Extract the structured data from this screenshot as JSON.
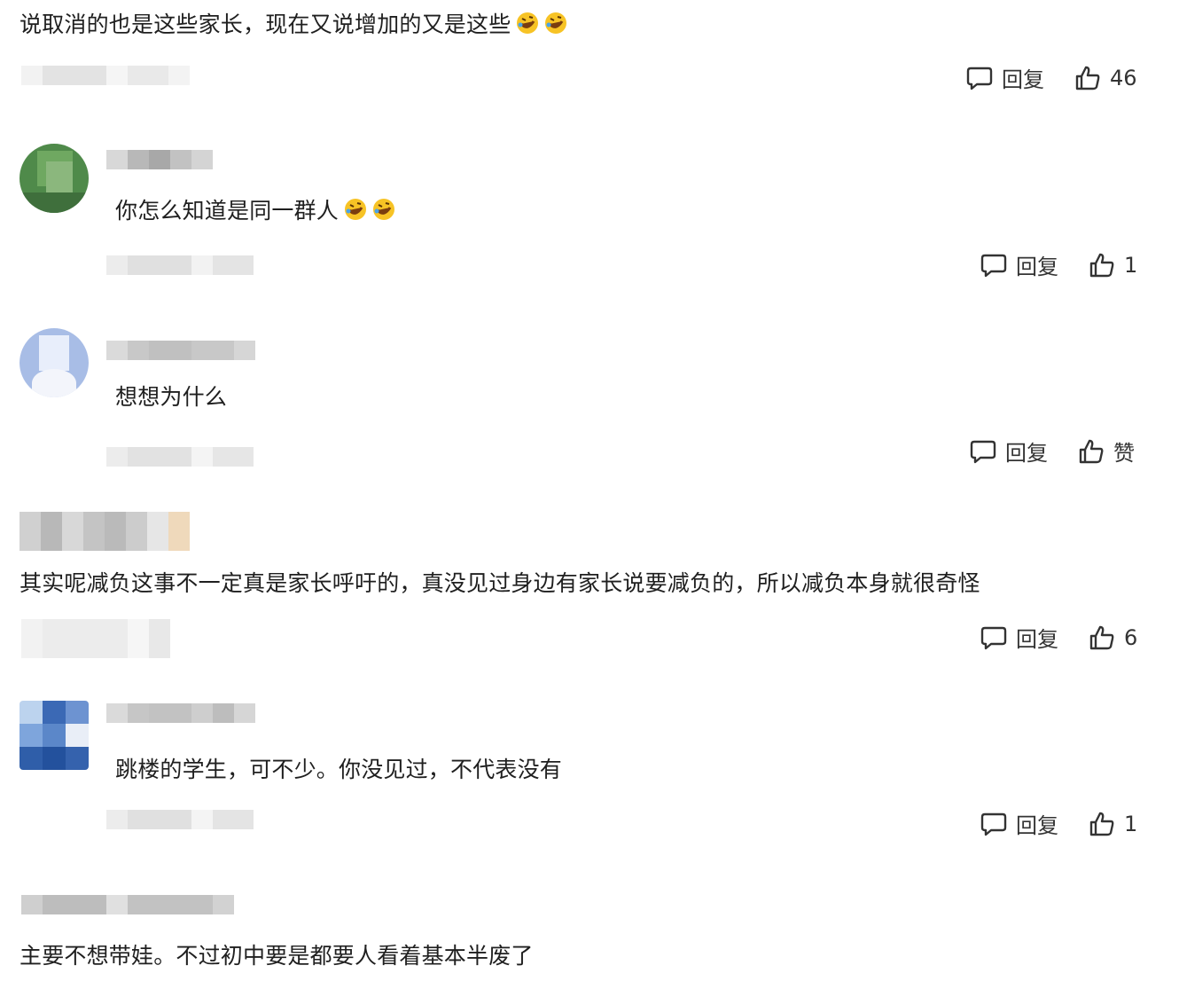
{
  "comments": [
    {
      "text": "说取消的也是这些家长，现在又说增加的又是这些",
      "reply_label": "回复",
      "likes": "46"
    },
    {
      "text": "你怎么知道是同一群人",
      "reply_label": "回复",
      "likes": "1"
    },
    {
      "text": "想想为什么",
      "reply_label": "回复",
      "likes": "赞"
    },
    {
      "text": "其实呢减负这事不一定真是家长呼吁的，真没见过身边有家长说要减负的，所以减负本身就很奇怪",
      "reply_label": "回复",
      "likes": "6"
    },
    {
      "text": "跳楼的学生，可不少。你没见过，不代表没有",
      "reply_label": "回复",
      "likes": "1"
    },
    {
      "text": "主要不想带娃。不过初中要是都要人看着基本半废了"
    }
  ],
  "icons": {
    "reply": "speech-bubble-icon",
    "like": "thumbs-up-icon",
    "emoji": "rofl-emoji-icon"
  },
  "colors": {
    "text": "#1f1f1f",
    "icon": "#333333",
    "blur_light": "#eeeeee",
    "blur_dark": "#bcbcbc"
  }
}
